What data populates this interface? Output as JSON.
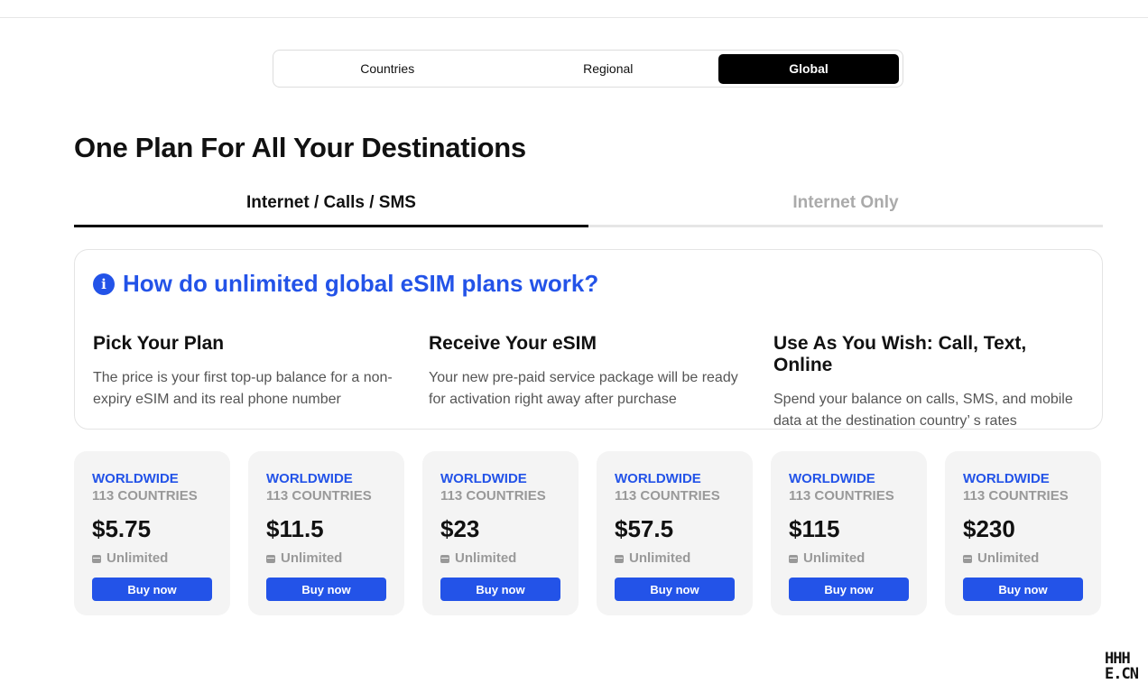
{
  "segments": {
    "items": [
      {
        "label": "Countries"
      },
      {
        "label": "Regional"
      },
      {
        "label": "Global"
      }
    ],
    "active": "Global"
  },
  "page_title": "One Plan For All Your Destinations",
  "tabs": {
    "items": [
      {
        "label": "Internet / Calls / SMS"
      },
      {
        "label": "Internet Only"
      }
    ],
    "active": "Internet / Calls / SMS"
  },
  "info": {
    "title": "How do unlimited global eSIM plans work?",
    "steps": [
      {
        "title": "Pick Your Plan",
        "text": "The price is your first top-up balance for a non-expiry eSIM and its real phone number"
      },
      {
        "title": "Receive Your eSIM",
        "text": "Your new pre-paid service package will be ready for activation right away after purchase"
      },
      {
        "title": "Use As You Wish: Call, Text, Online",
        "text": "Spend your balance on calls, SMS, and mobile data at the destination country’ s rates"
      }
    ]
  },
  "plans": [
    {
      "region": "WORLDWIDE",
      "countries": "113 COUNTRIES",
      "price": "$5.75",
      "data": "Unlimited",
      "button": "Buy now"
    },
    {
      "region": "WORLDWIDE",
      "countries": "113 COUNTRIES",
      "price": "$11.5",
      "data": "Unlimited",
      "button": "Buy now"
    },
    {
      "region": "WORLDWIDE",
      "countries": "113 COUNTRIES",
      "price": "$23",
      "data": "Unlimited",
      "button": "Buy now"
    },
    {
      "region": "WORLDWIDE",
      "countries": "113 COUNTRIES",
      "price": "$57.5",
      "data": "Unlimited",
      "button": "Buy now"
    },
    {
      "region": "WORLDWIDE",
      "countries": "113 COUNTRIES",
      "price": "$115",
      "data": "Unlimited",
      "button": "Buy now"
    },
    {
      "region": "WORLDWIDE",
      "countries": "113 COUNTRIES",
      "price": "$230",
      "data": "Unlimited",
      "button": "Buy now"
    }
  ],
  "watermark": {
    "line1": "HHH",
    "line2": "E.CN"
  },
  "colors": {
    "accent": "#2353e8",
    "active_segment": "#000000",
    "card_background": "#f4f4f4",
    "muted_text": "#999999"
  },
  "icons": {
    "info": "info-circle-icon",
    "data": "sim-card-icon"
  }
}
